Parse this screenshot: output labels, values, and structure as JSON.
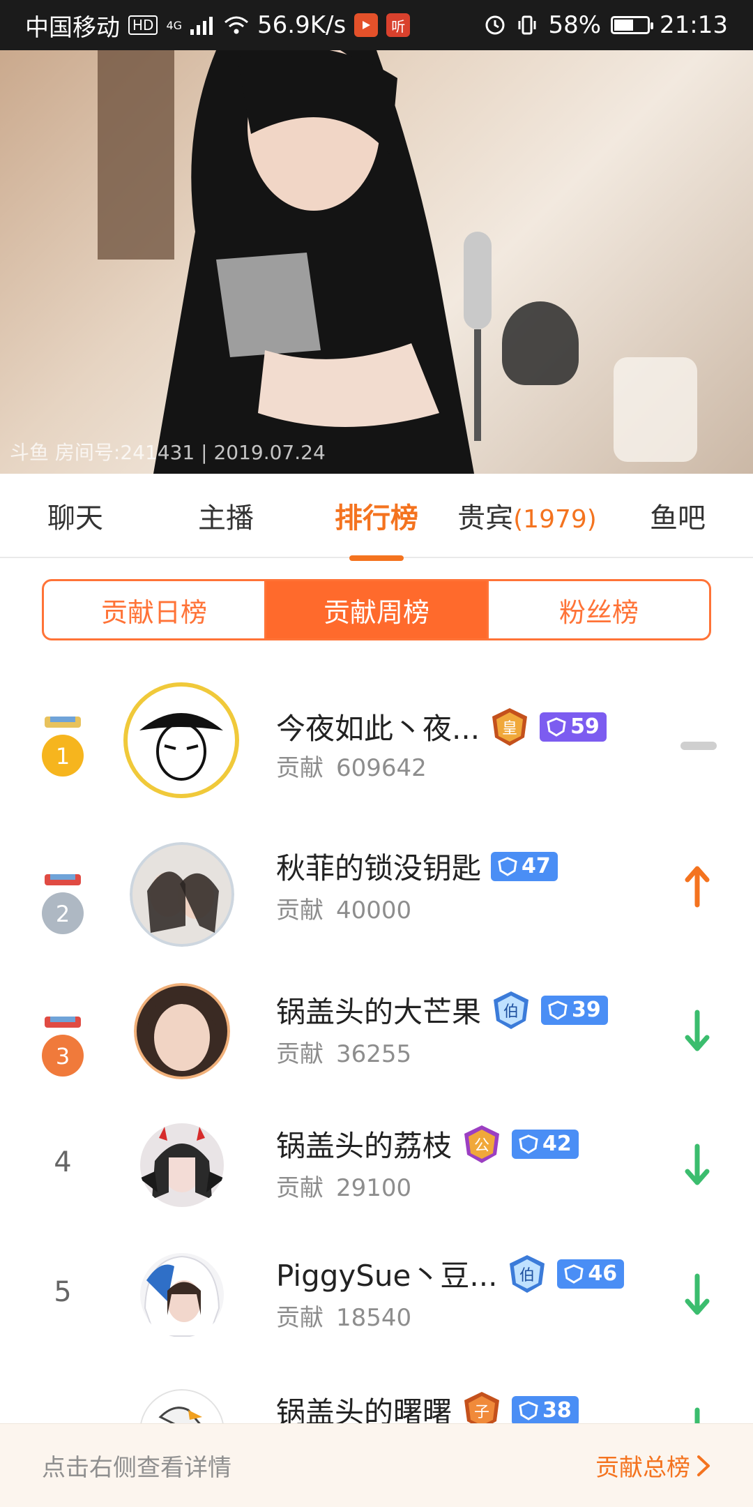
{
  "status_bar": {
    "carrier": "中国移动",
    "hd_badge": "HD",
    "network": "4G",
    "speed": "56.9K/s",
    "app_listen": "听",
    "battery_pct": "58%",
    "battery_level": 0.58,
    "time": "21:13"
  },
  "video": {
    "watermark": "斗鱼 房间号:241431 | 2019.07.24"
  },
  "tabs": [
    {
      "label": "聊天"
    },
    {
      "label": "主播"
    },
    {
      "label": "排行榜",
      "active": true
    },
    {
      "label": "贵宾",
      "count": "(1979)"
    },
    {
      "label": "鱼吧"
    }
  ],
  "segments": [
    {
      "label": "贡献日榜"
    },
    {
      "label": "贡献周榜",
      "active": true
    },
    {
      "label": "粉丝榜"
    }
  ],
  "ranking": [
    {
      "rank": "1",
      "medal_color": "#f6b51e",
      "name": "今夜如此丶夜...",
      "noble_badge": "皇",
      "level": "59",
      "level_color": "purple",
      "contribution_label": "贡献",
      "amount": "609642",
      "trend": "flat"
    },
    {
      "rank": "2",
      "medal_color": "#aeb8c3",
      "name": "秋菲的锁没钥匙",
      "noble_badge": "",
      "level": "47",
      "level_color": "blue",
      "contribution_label": "贡献",
      "amount": "40000",
      "trend": "up"
    },
    {
      "rank": "3",
      "medal_color": "#f07a3b",
      "name": "锅盖头的大芒果",
      "noble_badge": "伯",
      "level": "39",
      "level_color": "blue",
      "contribution_label": "贡献",
      "amount": "36255",
      "trend": "down"
    },
    {
      "rank": "4",
      "medal_color": "",
      "name": "锅盖头的荔枝",
      "noble_badge": "公",
      "level": "42",
      "level_color": "blue",
      "contribution_label": "贡献",
      "amount": "29100",
      "trend": "down"
    },
    {
      "rank": "5",
      "medal_color": "",
      "name": "PiggySue丶豆...",
      "noble_badge": "伯",
      "level": "46",
      "level_color": "blue",
      "contribution_label": "贡献",
      "amount": "18540",
      "trend": "down"
    },
    {
      "rank": "",
      "medal_color": "",
      "name": "锅盖头的曙曙",
      "noble_badge": "子",
      "level": "38",
      "level_color": "blue",
      "contribution_label": "",
      "amount": "",
      "trend": "down"
    }
  ],
  "bottom": {
    "hint": "点击右侧查看详情",
    "link": "贡献总榜"
  },
  "colors": {
    "accent": "#f4731f",
    "segment_active": "#ff6a2c",
    "trend_up": "#f4731f",
    "trend_down": "#3bbd6e"
  }
}
